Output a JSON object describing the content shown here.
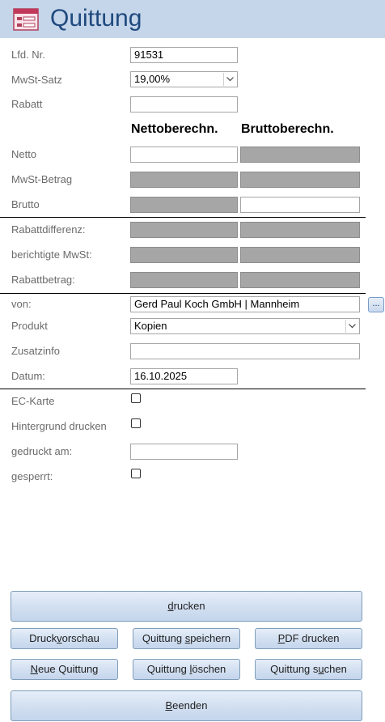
{
  "header": {
    "title": "Quittung",
    "icon": "form-icon"
  },
  "fields": {
    "lfd_nr": {
      "label": "Lfd. Nr.",
      "value": "91531"
    },
    "mwst_satz": {
      "label": "MwSt-Satz",
      "value": "19,00%"
    },
    "rabatt": {
      "label": "Rabatt",
      "value": ""
    }
  },
  "columns": {
    "netto": "Nettoberechn.",
    "brutto": "Bruttoberechn."
  },
  "calc_rows": {
    "netto": "Netto",
    "mwst_betrag": "MwSt-Betrag",
    "brutto": "Brutto",
    "rabattdifferenz": "Rabattdifferenz:",
    "berichtigte_mwst": "berichtigte MwSt:",
    "rabattbetrag": "Rabattbetrag:"
  },
  "details": {
    "von": {
      "label": "von:",
      "value": "Gerd Paul Koch GmbH | Mannheim",
      "lookup_button": "..."
    },
    "produkt": {
      "label": "Produkt",
      "value": "Kopien"
    },
    "zusatzinfo": {
      "label": "Zusatzinfo",
      "value": ""
    },
    "datum": {
      "label": "Datum:",
      "value": "16.10.2025"
    }
  },
  "flags": {
    "ec_karte": {
      "label": "EC-Karte",
      "checked": false
    },
    "hintergrund": {
      "label": "Hintergrund drucken",
      "checked": false
    },
    "gedruckt_am": {
      "label": "gedruckt am:",
      "value": ""
    },
    "gesperrt": {
      "label": "gesperrt:",
      "checked": false
    }
  },
  "buttons": {
    "drucken": {
      "pre": "",
      "key": "d",
      "post": "rucken"
    },
    "druckvorschau": {
      "pre": "Druck",
      "key": "v",
      "post": "orschau"
    },
    "speichern": {
      "pre": "Quittung ",
      "key": "s",
      "post": "peichern"
    },
    "pdf": {
      "pre": "",
      "key": "P",
      "post": "DF drucken"
    },
    "neue": {
      "pre": "",
      "key": "N",
      "post": "eue Quittung"
    },
    "loeschen": {
      "pre": "Quittung ",
      "key": "l",
      "post": "öschen"
    },
    "suchen": {
      "pre": "Quittung s",
      "key": "u",
      "post": "chen"
    },
    "beenden": {
      "pre": "",
      "key": "B",
      "post": "eenden"
    }
  },
  "colors": {
    "header_bg": "#c5d5ea",
    "title": "#1f497d",
    "locked_field": "#a6a6a6"
  }
}
